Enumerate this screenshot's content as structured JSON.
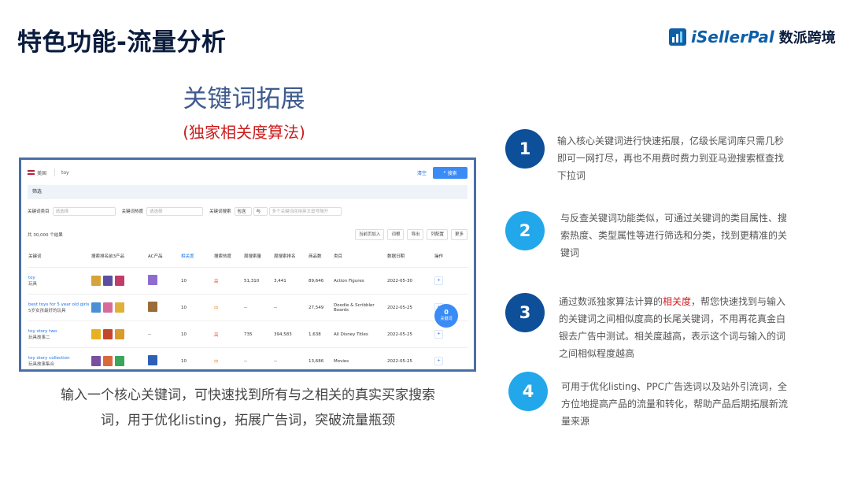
{
  "page": {
    "title": "特色功能-流量分析",
    "logo_en": "iSellerPal",
    "logo_cn": "数派跨境",
    "section_title": "关键词拓展",
    "section_subtitle": "(独家相关度算法)",
    "caption_line1": "输入一个核心关键词，可快速找到所有与之相关的真实买家搜索",
    "caption_line2": "词，用于优化listing，拓展广告词，突破流量瓶颈"
  },
  "screenshot": {
    "country": "美国",
    "query": "toy",
    "clear_label": "清空",
    "search_label": "搜索",
    "filter_section": "筛选",
    "filters": [
      {
        "label": "关键词类目",
        "placeholder": "请选择"
      },
      {
        "label": "关键词热度",
        "placeholder": "请选择"
      },
      {
        "label": "关键词搜索",
        "op1": "包含",
        "op2": "与",
        "placeholder": "多个关键词间用英文逗号隔开"
      }
    ],
    "result_count": "共 30,000 个结果",
    "toolbar": [
      "当前页加入",
      "词根",
      "导出",
      "列配置",
      "更多"
    ],
    "columns": [
      "关键词",
      "搜索排名前3产品",
      "AC产品",
      "相关度",
      "搜索热度",
      "周搜索量",
      "周搜索排名",
      "商品数",
      "类目",
      "数据日期",
      "操作"
    ],
    "rows": [
      {
        "keyword": "toy",
        "keyword_cn": "玩具",
        "ac": "",
        "relevance": "10",
        "heat": "高",
        "heat_level": "high",
        "weekly_volume": "51,310",
        "weekly_rank": "3,441",
        "products": "89,646",
        "category": "Action Figures",
        "date": "2022-05-30"
      },
      {
        "keyword": "best toys for 5 year old girls",
        "keyword_cn": "5岁女孩最好的玩具",
        "ac": "",
        "relevance": "10",
        "heat": "中",
        "heat_level": "mid",
        "weekly_volume": "--",
        "weekly_rank": "--",
        "products": "27,549",
        "category": "Doodle & Scribbler Boards",
        "date": "2022-05-25"
      },
      {
        "keyword": "toy story two",
        "keyword_cn": "玩具故事二",
        "ac": "--",
        "relevance": "10",
        "heat": "高",
        "heat_level": "high",
        "weekly_volume": "735",
        "weekly_rank": "394,583",
        "products": "1,638",
        "category": "All Disney Titles",
        "date": "2022-05-25"
      },
      {
        "keyword": "toy story collection",
        "keyword_cn": "玩具故事集合",
        "ac": "",
        "relevance": "10",
        "heat": "中",
        "heat_level": "mid",
        "weekly_volume": "--",
        "weekly_rank": "--",
        "products": "13,686",
        "category": "Movies",
        "date": "2022-05-25"
      }
    ],
    "action": "+",
    "badge_count": "0",
    "badge_label": "关键词"
  },
  "features": [
    {
      "num": "1",
      "text": "输入核心关键词进行快速拓展，亿级长尾词库只需几秒即可一网打尽，再也不用费时费力到亚马逊搜索框查找下拉词"
    },
    {
      "num": "2",
      "text": "与反查关键词功能类似，可通过关键词的类目属性、搜索热度、类型属性等进行筛选和分类，找到更精准的关键词"
    },
    {
      "num": "3",
      "text_before": "通过数派独家算法计算的",
      "text_highlight": "相关度",
      "text_after": "，帮您快速找到与输入的关键词之间相似度高的长尾关键词，不用再花真金白银去广告中测试。相关度越高，表示这个词与输入的词之间相似程度越高"
    },
    {
      "num": "4",
      "text": "可用于优化listing、PPC广告选词以及站外引流词，全方位地提高产品的流量和转化，帮助产品后期拓展新流量来源"
    }
  ],
  "colors": {
    "dark_circle": "#0d4f99",
    "light_circle": "#22a7ea",
    "title": "#0a1c3d",
    "accent_red": "#cc1d1d",
    "frame": "#4a6ea8"
  }
}
